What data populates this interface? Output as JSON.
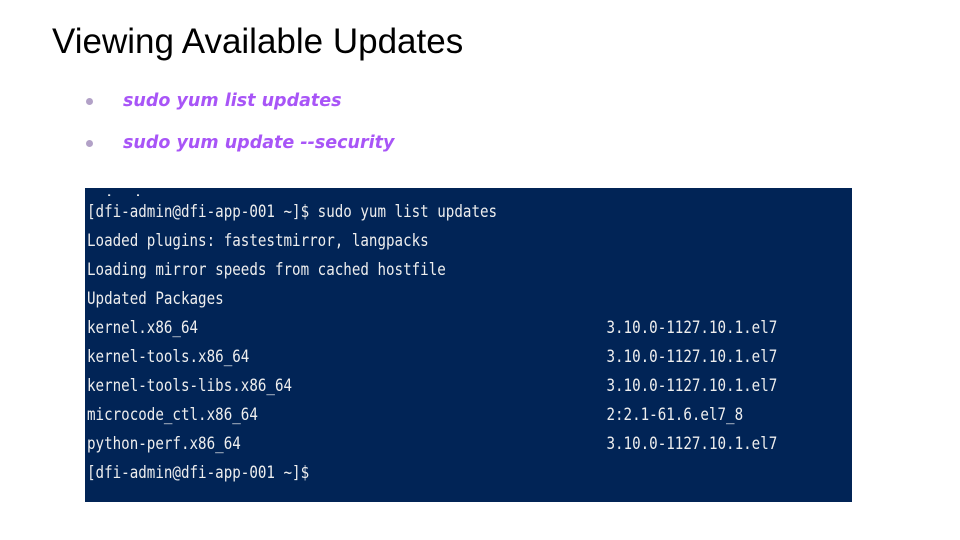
{
  "slide": {
    "title": "Viewing Available Updates",
    "bullets": [
      "sudo yum list updates",
      "sudo yum update --security"
    ]
  },
  "terminal": {
    "background_color": "#012456",
    "text_color": "#eeeeee",
    "top_clipped_fragment": "  ,  ,        _",
    "header_lines": [
      "[dfi-admin@dfi-app-001 ~]$ sudo yum list updates",
      "Loaded plugins: fastestmirror, langpacks",
      "Loading mirror speeds from cached hostfile",
      "Updated Packages"
    ],
    "packages": [
      {
        "name": "kernel.x86_64",
        "version": "3.10.0-1127.10.1.el7"
      },
      {
        "name": "kernel-tools.x86_64",
        "version": "3.10.0-1127.10.1.el7"
      },
      {
        "name": "kernel-tools-libs.x86_64",
        "version": "3.10.0-1127.10.1.el7"
      },
      {
        "name": "microcode_ctl.x86_64",
        "version": "2:2.1-61.6.el7_8"
      },
      {
        "name": "python-perf.x86_64",
        "version": "3.10.0-1127.10.1.el7"
      }
    ],
    "final_prompt": "[dfi-admin@dfi-app-001 ~]$"
  },
  "colors": {
    "bullet_text": "#a855f7",
    "bullet_dot": "#b2a1c7",
    "title": "#000000"
  }
}
